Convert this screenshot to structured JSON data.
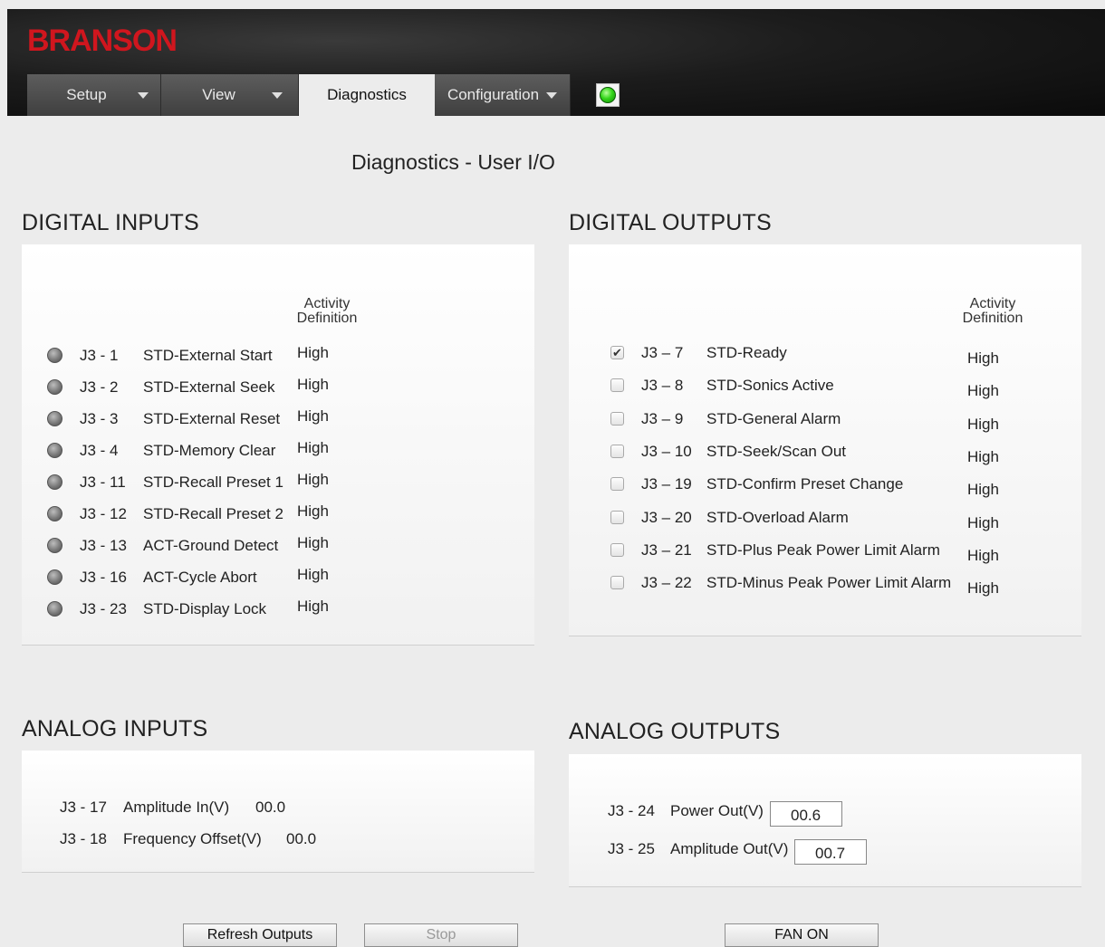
{
  "header": {
    "logo": "BRANSON",
    "tabs": [
      {
        "label": "Setup",
        "has_dropdown": true
      },
      {
        "label": "View",
        "has_dropdown": true
      },
      {
        "label": "Diagnostics",
        "has_dropdown": false,
        "active": true
      },
      {
        "label": "Configuration",
        "has_dropdown": true
      }
    ],
    "status_indicator": {
      "color": "#22cc11",
      "state": "ok"
    }
  },
  "page_title": "Diagnostics - User I/O",
  "digital_inputs": {
    "title": "DIGITAL INPUTS",
    "activity_header": [
      "Activity",
      "Definition"
    ],
    "rows": [
      {
        "pin": "J3 - 1",
        "name": "STD-External Start",
        "activity": "High"
      },
      {
        "pin": "J3 - 2",
        "name": "STD-External Seek",
        "activity": "High"
      },
      {
        "pin": "J3 - 3",
        "name": "STD-External Reset",
        "activity": "High"
      },
      {
        "pin": "J3 - 4",
        "name": "STD-Memory Clear",
        "activity": "High"
      },
      {
        "pin": "J3 - 11",
        "name": "STD-Recall Preset 1",
        "activity": "High"
      },
      {
        "pin": "J3 - 12",
        "name": "STD-Recall Preset 2",
        "activity": "High"
      },
      {
        "pin": "J3 - 13",
        "name": "ACT-Ground Detect",
        "activity": "High"
      },
      {
        "pin": "J3 - 16",
        "name": "ACT-Cycle Abort",
        "activity": "High"
      },
      {
        "pin": "J3 - 23",
        "name": "STD-Display Lock",
        "activity": "High"
      }
    ]
  },
  "digital_outputs": {
    "title": "DIGITAL OUTPUTS",
    "activity_header": [
      "Activity",
      "Definition"
    ],
    "rows": [
      {
        "pin": "J3 – 7",
        "name": "STD-Ready",
        "activity": "High",
        "checked": true
      },
      {
        "pin": "J3 – 8",
        "name": "STD-Sonics Active",
        "activity": "High",
        "checked": false
      },
      {
        "pin": "J3 – 9",
        "name": "STD-General Alarm",
        "activity": "High",
        "checked": false
      },
      {
        "pin": "J3 – 10",
        "name": "STD-Seek/Scan Out",
        "activity": "High",
        "checked": false
      },
      {
        "pin": "J3 – 19",
        "name": "STD-Confirm Preset Change",
        "activity": "High",
        "checked": false
      },
      {
        "pin": "J3 – 20",
        "name": "STD-Overload Alarm",
        "activity": "High",
        "checked": false
      },
      {
        "pin": "J3 – 21",
        "name": "STD-Plus Peak Power Limit Alarm",
        "activity": "High",
        "checked": false
      },
      {
        "pin": "J3 – 22",
        "name": "STD-Minus Peak Power Limit Alarm",
        "activity": "High",
        "checked": false
      }
    ]
  },
  "analog_inputs": {
    "title": "ANALOG INPUTS",
    "rows": [
      {
        "pin": "J3 - 17",
        "name": "Amplitude In(V)",
        "value": "00.0"
      },
      {
        "pin": "J3 - 18",
        "name": "Frequency Offset(V)",
        "value": "00.0"
      }
    ]
  },
  "analog_outputs": {
    "title": "ANALOG OUTPUTS",
    "rows": [
      {
        "pin": "J3 - 24",
        "name": "Power Out(V)",
        "value": "00.6"
      },
      {
        "pin": "J3 - 25",
        "name": "Amplitude Out(V)",
        "value": "00.7"
      }
    ]
  },
  "buttons": {
    "refresh": "Refresh Outputs",
    "stop": "Stop",
    "fan": "FAN ON"
  }
}
